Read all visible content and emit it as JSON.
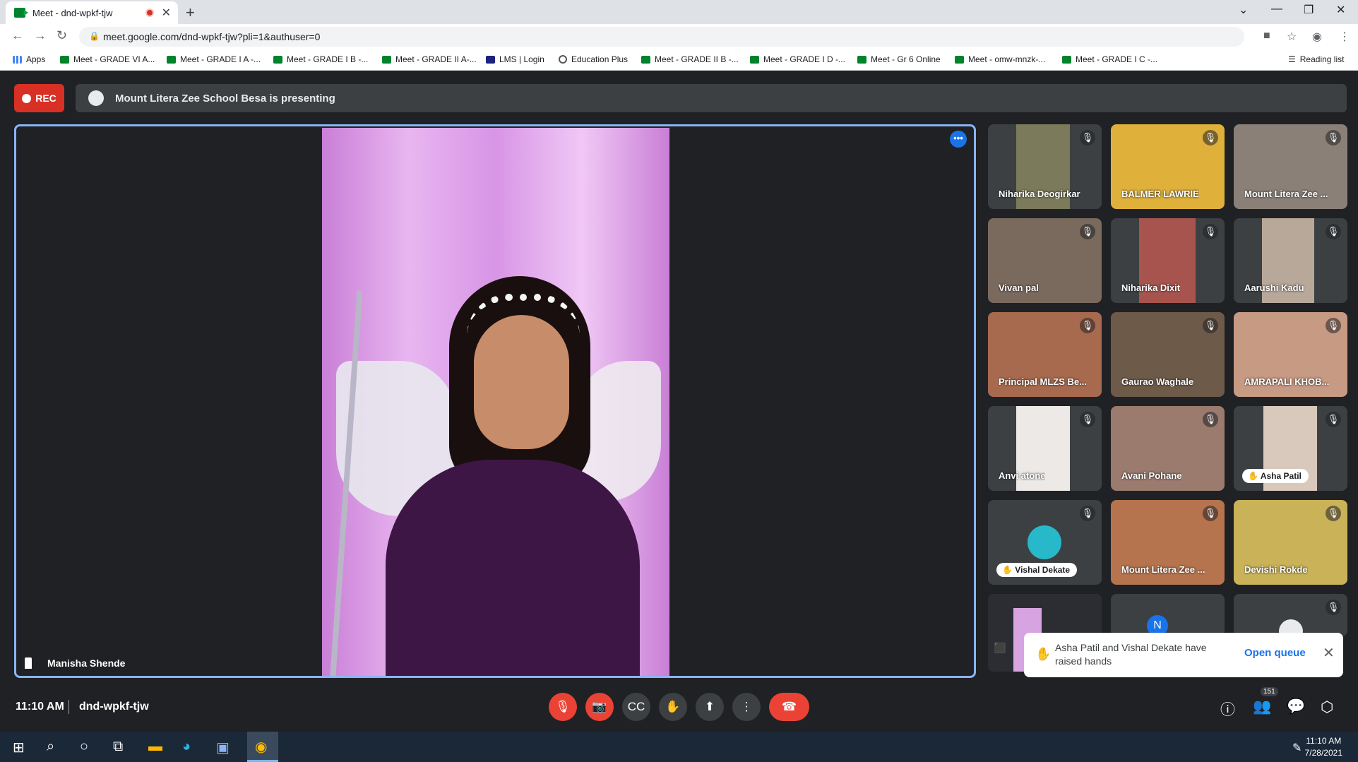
{
  "browser": {
    "tab_title": "Meet - dnd-wpkf-tjw",
    "tab_close": "✕",
    "new_tab": "+",
    "url": "meet.google.com/dnd-wpkf-tjw?pli=1&authuser=0",
    "bookmarks": [
      "Apps",
      "Meet - GRADE VI A...",
      "Meet - GRADE I A -...",
      "Meet - GRADE I B -...",
      "Meet - GRADE II A-...",
      "LMS | Login",
      "Education Plus",
      "Meet - GRADE II B -...",
      "Meet - GRADE I D -...",
      "Meet - Gr 6 Online",
      "Meet - omw-mnzk-...",
      "Meet - GRADE I C -..."
    ],
    "reading_list": "Reading list"
  },
  "meet": {
    "rec_label": "REC",
    "presenting_text": "Mount Litera Zee School Besa is presenting",
    "main_speaker": "Manisha Shende",
    "participants": [
      {
        "name": "Niharika Deogirkar"
      },
      {
        "name": "BALMER LAWRIE"
      },
      {
        "name": "Mount Litera Zee ..."
      },
      {
        "name": "Vivan pal"
      },
      {
        "name": "Niharika Dixit"
      },
      {
        "name": "Aarushi Kadu"
      },
      {
        "name": "Principal MLZS Be..."
      },
      {
        "name": "Gaurao Waghale"
      },
      {
        "name": "AMRAPALI KHOB..."
      },
      {
        "name": "Anvi atone"
      },
      {
        "name": "Avani Pohane"
      },
      {
        "name": "Asha Patil"
      },
      {
        "name": "Vishal Dekate"
      },
      {
        "name": "Mount Litera Zee ..."
      },
      {
        "name": "Devishi Rokde"
      }
    ],
    "avatar_letter": "N",
    "toast": {
      "message": "Asha Patil and Vishal Dekate have raised hands",
      "action": "Open queue"
    },
    "time": "11:10 AM",
    "meeting_code": "dnd-wpkf-tjw",
    "people_count": "151"
  },
  "taskbar": {
    "time": "11:10 AM",
    "date": "7/28/2021"
  }
}
